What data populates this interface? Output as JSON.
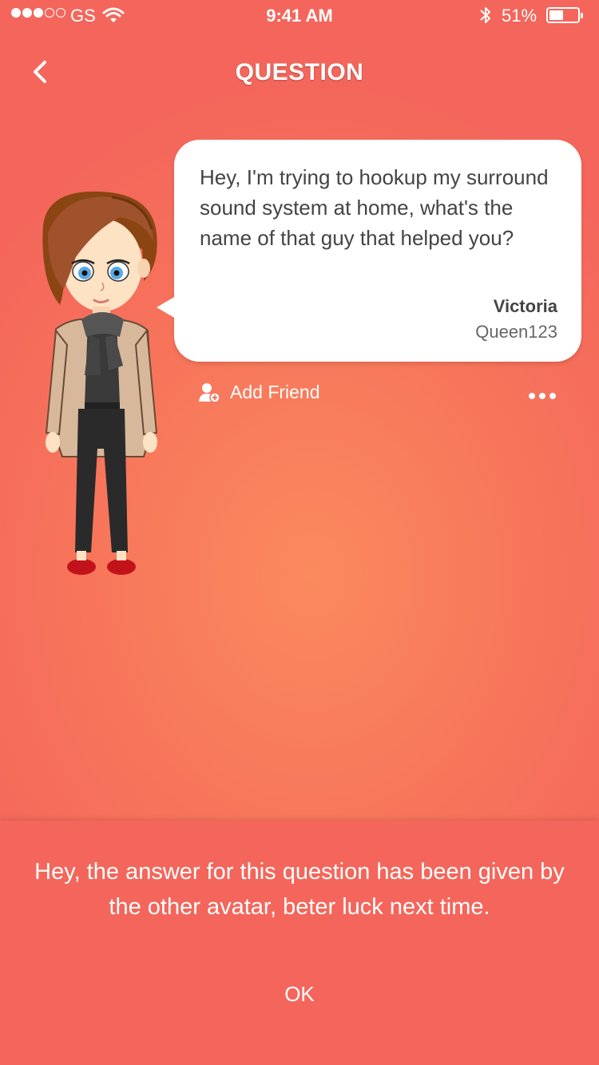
{
  "status_bar": {
    "carrier": "GS",
    "time": "9:41 AM",
    "battery_percent": "51%",
    "battery_level": 0.51,
    "signal_bars": 3,
    "signal_total": 5,
    "wifi_icon": "wifi-icon",
    "bluetooth_icon": "bluetooth-icon"
  },
  "nav": {
    "title": "QUESTION",
    "back_icon": "chevron-left-icon"
  },
  "question": {
    "text": "Hey, I'm trying to hookup my surround sound system at home, what's the name of that guy that helped you?",
    "author_name": "Victoria",
    "author_handle": "Queen123"
  },
  "actions": {
    "add_friend_label": "Add Friend",
    "add_friend_icon": "add-user-icon",
    "more_icon": "more-dots-icon"
  },
  "notice": {
    "message": "Hey, the answer for this question has been given by the other avatar, beter luck next time.",
    "ok_label": "OK"
  },
  "colors": {
    "background_center": "#fb8a5e",
    "background_edge": "#f4665b",
    "panel": "#f4665b",
    "bubble": "#ffffff"
  }
}
